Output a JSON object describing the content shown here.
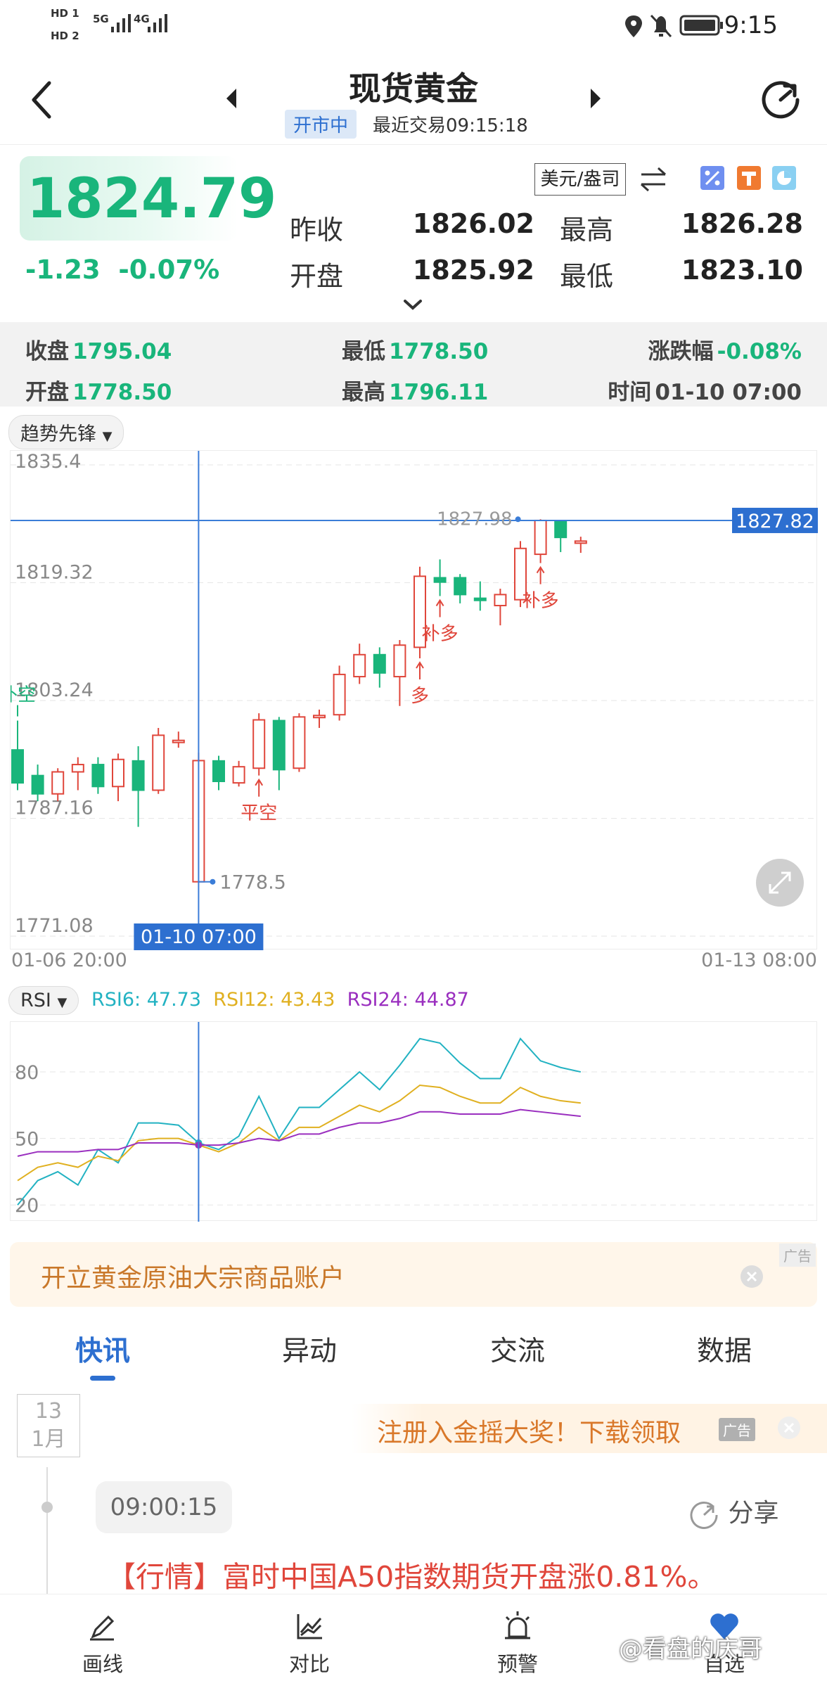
{
  "status_bar": {
    "sim1": "HD 1",
    "sim2": "HD 2",
    "net1": "5G",
    "net2": "4G",
    "time": "9:15"
  },
  "header": {
    "title": "现货黄金",
    "market_status": "开市中",
    "last_trade": "最近交易09:15:18"
  },
  "quote": {
    "price": "1824.79",
    "change": "-1.23",
    "change_pct": "-0.07%",
    "prev_close_label": "昨收",
    "prev_close": "1826.02",
    "open_label": "开盘",
    "open": "1825.92",
    "high_label": "最高",
    "high": "1826.28",
    "low_label": "最低",
    "low": "1823.10",
    "currency": "美元/盎司"
  },
  "crosshair_ohlc": {
    "close_label": "收盘",
    "close": "1795.04",
    "low_label": "最低",
    "low": "1778.50",
    "change_label": "涨跌幅",
    "change": "-0.08%",
    "open_label": "开盘",
    "open": "1778.50",
    "high_label": "最高",
    "high": "1796.11",
    "time_label": "时间",
    "time": "01-10 07:00"
  },
  "indicator_select": "趋势先锋",
  "rsi_select": "RSI",
  "rsi": {
    "rsi6_label": "RSI6:",
    "rsi6": "47.73",
    "rsi12_label": "RSI12:",
    "rsi12": "43.43",
    "rsi24_label": "RSI24:",
    "rsi24": "44.87"
  },
  "chart_data": [
    {
      "type": "candlestick",
      "title": "",
      "ylim": [
        1771.08,
        1835.4
      ],
      "y_ticks": [
        "1835.4",
        "1819.32",
        "1803.24",
        "1787.16",
        "1771.08"
      ],
      "x_start": "01-06 20:00",
      "x_end": "01-13 08:00",
      "crosshair_x_label": "01-10 07:00",
      "last_price_label": "1827.82",
      "max_label": "1827.98",
      "min_label": "1778.5",
      "signals": [
        "补空",
        "平空",
        "多",
        "补多",
        "补多"
      ],
      "candles": [
        {
          "o": 1796.5,
          "c": 1792.0,
          "h": 1800.5,
          "l": 1791.0
        },
        {
          "o": 1793.0,
          "c": 1790.5,
          "h": 1794.5,
          "l": 1789.5
        },
        {
          "o": 1790.5,
          "c": 1793.5,
          "h": 1794.0,
          "l": 1789.5
        },
        {
          "o": 1793.5,
          "c": 1794.5,
          "h": 1795.5,
          "l": 1791.0
        },
        {
          "o": 1794.5,
          "c": 1791.5,
          "h": 1795.5,
          "l": 1790.5
        },
        {
          "o": 1791.5,
          "c": 1795.2,
          "h": 1796.0,
          "l": 1789.5
        },
        {
          "o": 1795.0,
          "c": 1791.0,
          "h": 1797.0,
          "l": 1786.0
        },
        {
          "o": 1791.0,
          "c": 1798.5,
          "h": 1799.5,
          "l": 1790.5
        },
        {
          "o": 1797.8,
          "c": 1797.8,
          "h": 1799.0,
          "l": 1796.8
        },
        {
          "o": 1778.5,
          "c": 1795.04,
          "h": 1796.11,
          "l": 1778.5
        },
        {
          "o": 1795.0,
          "c": 1792.2,
          "h": 1795.7,
          "l": 1791.0
        },
        {
          "o": 1792.0,
          "c": 1794.2,
          "h": 1795.0,
          "l": 1791.5
        },
        {
          "o": 1794.0,
          "c": 1800.6,
          "h": 1801.5,
          "l": 1793.0
        },
        {
          "o": 1800.5,
          "c": 1793.8,
          "h": 1801.0,
          "l": 1791.0
        },
        {
          "o": 1794.0,
          "c": 1801.0,
          "h": 1801.5,
          "l": 1793.5
        },
        {
          "o": 1801.0,
          "c": 1801.2,
          "h": 1802.0,
          "l": 1799.5
        },
        {
          "o": 1801.3,
          "c": 1806.8,
          "h": 1808.0,
          "l": 1800.5
        },
        {
          "o": 1806.5,
          "c": 1809.5,
          "h": 1811.0,
          "l": 1805.5
        },
        {
          "o": 1809.5,
          "c": 1807.0,
          "h": 1810.5,
          "l": 1805.0
        },
        {
          "o": 1806.5,
          "c": 1810.8,
          "h": 1811.5,
          "l": 1802.5
        },
        {
          "o": 1810.5,
          "c": 1820.2,
          "h": 1821.5,
          "l": 1809.0
        },
        {
          "o": 1820.0,
          "c": 1819.4,
          "h": 1822.5,
          "l": 1817.5
        },
        {
          "o": 1820.0,
          "c": 1817.7,
          "h": 1820.5,
          "l": 1816.5
        },
        {
          "o": 1817.2,
          "c": 1816.9,
          "h": 1819.5,
          "l": 1815.5
        },
        {
          "o": 1816.2,
          "c": 1817.7,
          "h": 1818.5,
          "l": 1813.5
        },
        {
          "o": 1817.0,
          "c": 1824.0,
          "h": 1825.0,
          "l": 1816.0
        },
        {
          "o": 1823.2,
          "c": 1827.82,
          "h": 1827.98,
          "l": 1822.0
        },
        {
          "o": 1827.8,
          "c": 1825.5,
          "h": 1827.9,
          "l": 1823.5
        },
        {
          "o": 1825.0,
          "c": 1825.0,
          "h": 1825.6,
          "l": 1823.4
        }
      ]
    },
    {
      "type": "line",
      "title": "RSI",
      "ylim": [
        15,
        100
      ],
      "y_ticks": [
        "80",
        "50",
        "20"
      ],
      "series": [
        {
          "name": "RSI6",
          "color": "#22b2c2",
          "values": [
            20,
            31,
            35,
            29,
            45,
            39,
            57,
            57,
            56,
            48,
            45,
            51,
            69,
            50,
            64,
            64,
            72,
            80,
            72,
            83,
            95,
            93,
            84,
            77,
            77,
            95,
            85,
            82,
            80
          ]
        },
        {
          "name": "RSI12",
          "color": "#e0b020",
          "values": [
            31,
            37,
            39,
            37,
            42,
            40,
            49,
            50,
            50,
            47,
            44,
            48,
            55,
            49,
            55,
            55,
            60,
            65,
            62,
            67,
            74,
            73,
            69,
            66,
            66,
            73,
            69,
            67,
            66
          ]
        },
        {
          "name": "RSI24",
          "color": "#9a2fbf",
          "values": [
            42,
            44,
            44,
            44,
            45,
            45,
            48,
            48,
            48,
            47,
            47,
            48,
            50,
            49,
            52,
            52,
            55,
            57,
            57,
            59,
            62,
            62,
            61,
            61,
            61,
            63,
            62,
            61,
            60
          ]
        }
      ]
    }
  ],
  "ad_banner": {
    "text": "开立黄金原油大宗商品账户",
    "tag": "广告"
  },
  "tabs": [
    "快讯",
    "异动",
    "交流",
    "数据"
  ],
  "news": {
    "day": "13",
    "month": "1月",
    "ad_text": "注册入金摇大奖！下载领取",
    "ad_tag": "广告",
    "time": "09:00:15",
    "share": "分享",
    "headline": "【行情】富时中国A50指数期货开盘涨0.81%。"
  },
  "bottom_nav": [
    "画线",
    "对比",
    "预警",
    "自选"
  ],
  "watermark": "@看盘的庆哥"
}
